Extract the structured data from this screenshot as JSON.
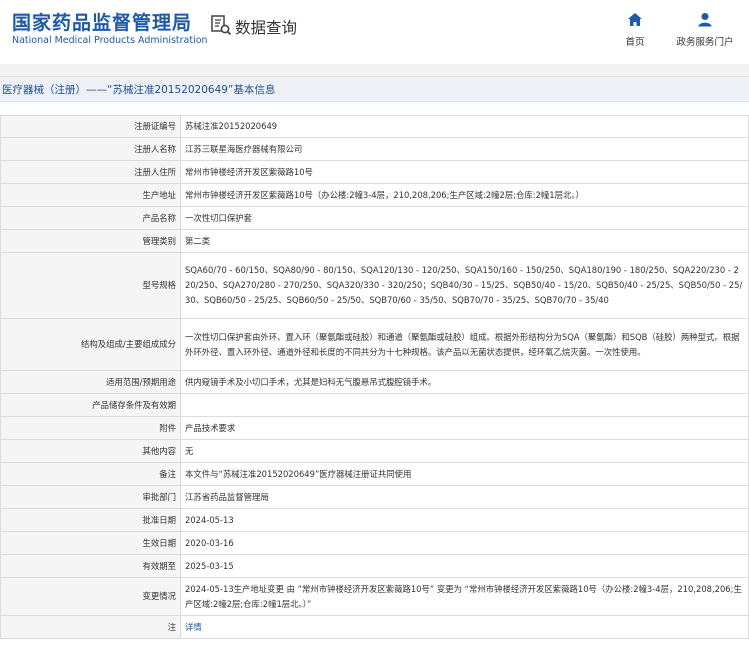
{
  "header": {
    "logo_cn": "国家药品监督管理局",
    "logo_en": "National Medical Products Administration",
    "query_label": "数据查询",
    "nav": [
      {
        "label": "首页",
        "icon": "home-icon"
      },
      {
        "label": "政务服务门户",
        "icon": "user-icon"
      }
    ]
  },
  "title": "医疗器械（注册）——“苏械注准20152020649”基本信息",
  "rows": [
    {
      "key": "注册证编号",
      "value": "苏械注准20152020649"
    },
    {
      "key": "注册人名称",
      "value": "江苏三联星海医疗器械有限公司"
    },
    {
      "key": "注册人住所",
      "value": "常州市钟楼经济开发区紫薇路10号"
    },
    {
      "key": "生产地址",
      "value": "常州市钟楼经济开发区紫薇路10号（办公楼:2幢3-4层，210,208,206;生产区域:2幢2层;仓库:2幢1层北。）"
    },
    {
      "key": "产品名称",
      "value": "一次性切口保护套"
    },
    {
      "key": "管理类别",
      "value": "第二类"
    },
    {
      "key": "型号规格",
      "value": "SQA60/70 - 60/150、SQA80/90 - 80/150、SQA120/130 - 120/250、SQA150/160 - 150/250、SQA180/190 - 180/250、SQA220/230 - 220/250、SQA270/280 - 270/250、SQA320/330 - 320/250；SQB40/30 - 15/25、SQB50/40 - 15/20、SQB50/40 - 25/25、SQB50/50 - 25/30、SQB60/50 - 25/25、SQB60/50 - 25/50、SQB70/60 - 35/50、SQB70/70 - 35/25、SQB70/70 - 35/40"
    },
    {
      "key": "结构及组成/主要组成成分",
      "value": "一次性切口保护套由外环、置入环（聚氨酯或硅胶）和通道（聚氨酯或硅胶）组成。根据外形结构分为SQA（聚氨酯）和SQB（硅胶）两种型式。根据外环外径、置入环外径、通道外径和长度的不同共分为十七种规格。该产品以无菌状态提供，经环氧乙烷灭菌。一次性使用。"
    },
    {
      "key": "适用范围/预期用途",
      "value": "供内窥镜手术及小切口手术，尤其是妇科无气腹悬吊式腹腔镜手术。"
    },
    {
      "key": "产品储存条件及有效期",
      "value": ""
    },
    {
      "key": "附件",
      "value": "产品技术要求"
    },
    {
      "key": "其他内容",
      "value": "无"
    },
    {
      "key": "备注",
      "value": "本文件与“苏械注准20152020649”医疗器械注册证共同使用"
    },
    {
      "key": "审批部门",
      "value": "江苏省药品监督管理局"
    },
    {
      "key": "批准日期",
      "value": "2024-05-13"
    },
    {
      "key": "生效日期",
      "value": "2020-03-16"
    },
    {
      "key": "有效期至",
      "value": "2025-03-15"
    },
    {
      "key": "变更情况",
      "value": "2024-05-13生产地址变更 由 “常州市钟楼经济开发区紫薇路10号” 变更为 “常州市钟楼经济开发区紫薇路10号（办公楼:2幢3-4层，210,208,206;生产区域:2幢2层;仓库:2幢1层北。）”"
    }
  ],
  "note": {
    "key": "注",
    "value": "详情"
  }
}
